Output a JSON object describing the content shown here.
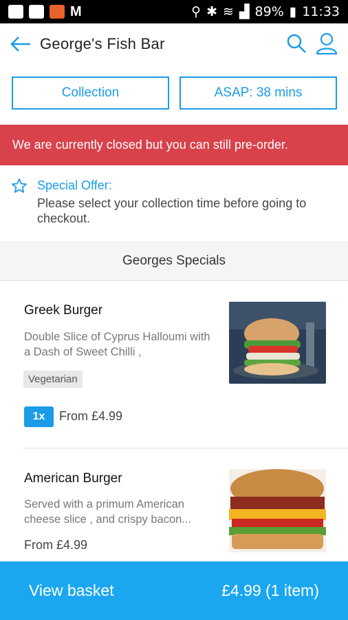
{
  "status_bar": {
    "battery": "89%",
    "time": "11:33"
  },
  "header": {
    "title": "George's Fish Bar"
  },
  "order_options": {
    "collection_label": "Collection",
    "time_label": "ASAP: 38 mins"
  },
  "banner": {
    "closed_text": "We are currently closed but you can still pre-order."
  },
  "offer": {
    "title": "Special Offer:",
    "text": "Please select your collection time before going to checkout."
  },
  "section": {
    "title": "Georges Specials"
  },
  "items": [
    {
      "name": "Greek Burger",
      "description": "Double Slice of Cyprus Halloumi with a Dash of Sweet Chilli ,",
      "tag": "Vegetarian",
      "quantity": "1x",
      "price": "From £4.99"
    },
    {
      "name": "American Burger",
      "description": "Served with a primum American cheese slice , and crispy bacon...",
      "price": "From £4.99"
    }
  ],
  "basket": {
    "label": "View basket",
    "total": "£4.99 (1 item)"
  },
  "colors": {
    "accent": "#1a9ce8",
    "banner": "#d9414b",
    "basket_bar": "#1aa7ef"
  }
}
